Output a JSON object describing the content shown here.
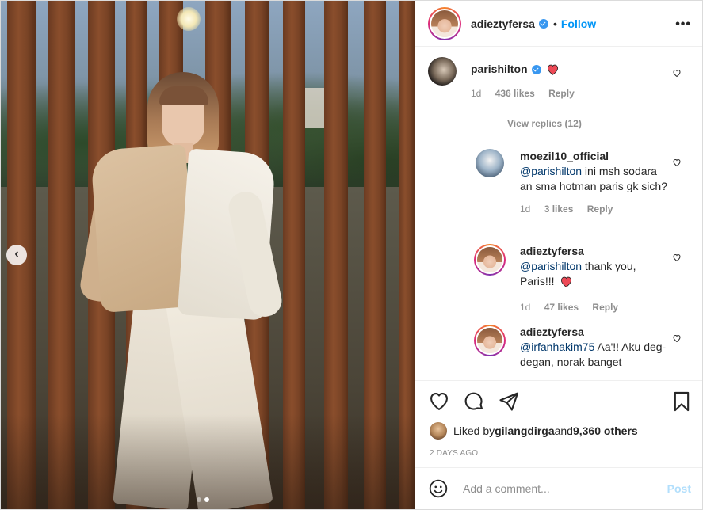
{
  "post": {
    "author": "adieztyfersa",
    "separator": "•",
    "follow_label": "Follow",
    "more_icon": "more-horizontal-icon"
  },
  "comments": [
    {
      "user": "parishilton",
      "verified": true,
      "text": "",
      "emoji": "red-heart",
      "age": "1d",
      "likes": "436 likes",
      "reply": "Reply"
    },
    {
      "user": "moezil10_official",
      "mention": "@parishilton",
      "text": " ini msh sodara an sma hotman paris gk sich?",
      "age": "1d",
      "likes": "3 likes",
      "reply": "Reply"
    },
    {
      "user": "adieztyfersa",
      "mention": "@parishilton",
      "text": " thank you, Paris!!!",
      "emoji": "red-heart",
      "age": "1d",
      "likes": "47 likes",
      "reply": "Reply"
    },
    {
      "user": "adieztyfersa",
      "mention": "@irfanhakim75",
      "text": " Aa'!! Aku deg-degan, norak banget"
    }
  ],
  "view_replies": "View replies (12)",
  "liked_by": {
    "prefix": "Liked by ",
    "user": "gilangdirga",
    "middle": " and ",
    "others": "9,360 others"
  },
  "time_ago": "2 DAYS AGO",
  "add_comment": {
    "placeholder": "Add a comment...",
    "post_label": "Post"
  },
  "carousel": {
    "prev_glyph": "‹",
    "slide_count": 2,
    "active_slide": 2
  },
  "colors": {
    "accent": "#0095f6",
    "verified": "#3897f0",
    "heart": "#ed4956",
    "muted": "#8e8e8e"
  }
}
